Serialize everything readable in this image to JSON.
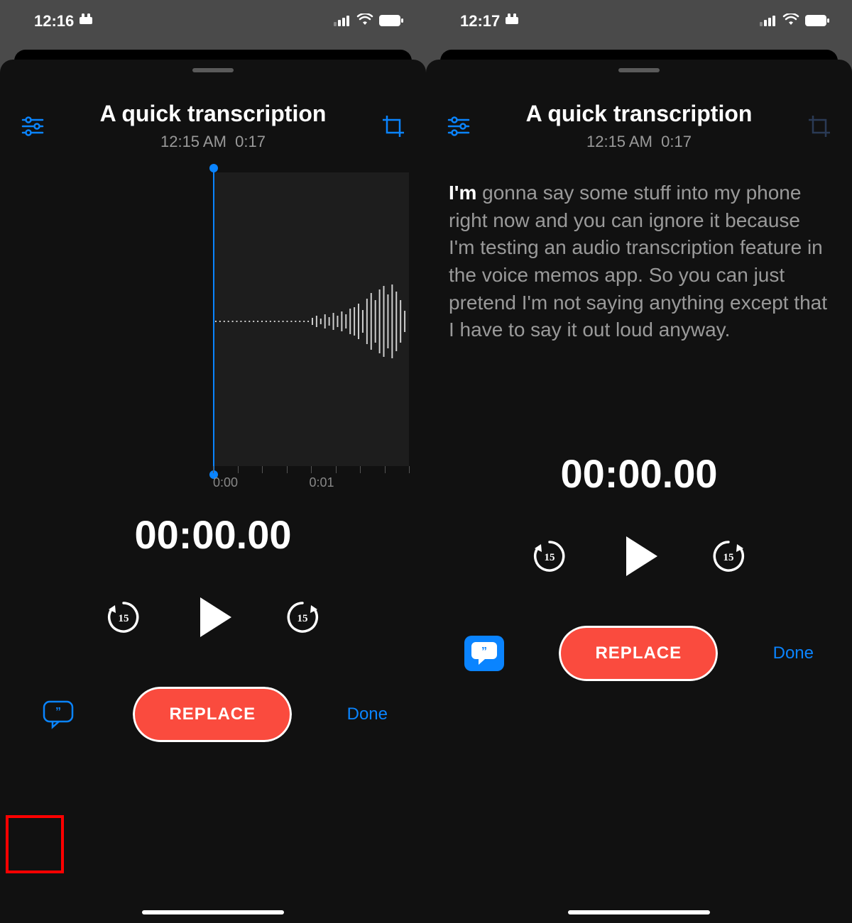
{
  "left": {
    "status": {
      "time": "12:16"
    },
    "recording": {
      "title": "A quick transcription",
      "timestamp": "12:15 AM",
      "duration": "0:17"
    },
    "timeline": {
      "ticks": [
        "0:00",
        "0:01"
      ]
    },
    "playback_time": "00:00.00",
    "skip_seconds": "15",
    "replace_label": "REPLACE",
    "done_label": "Done"
  },
  "right": {
    "status": {
      "time": "12:17"
    },
    "recording": {
      "title": "A quick transcription",
      "timestamp": "12:15 AM",
      "duration": "0:17"
    },
    "transcript": {
      "highlight": "I'm",
      "rest": " gonna say some stuff into my phone right now and you can ignore it because I'm testing an audio transcription feature in the voice memos app. So you can just pretend I'm not saying anything except that I have to say it out loud anyway."
    },
    "playback_time": "00:00.00",
    "skip_seconds": "15",
    "replace_label": "REPLACE",
    "done_label": "Done"
  }
}
